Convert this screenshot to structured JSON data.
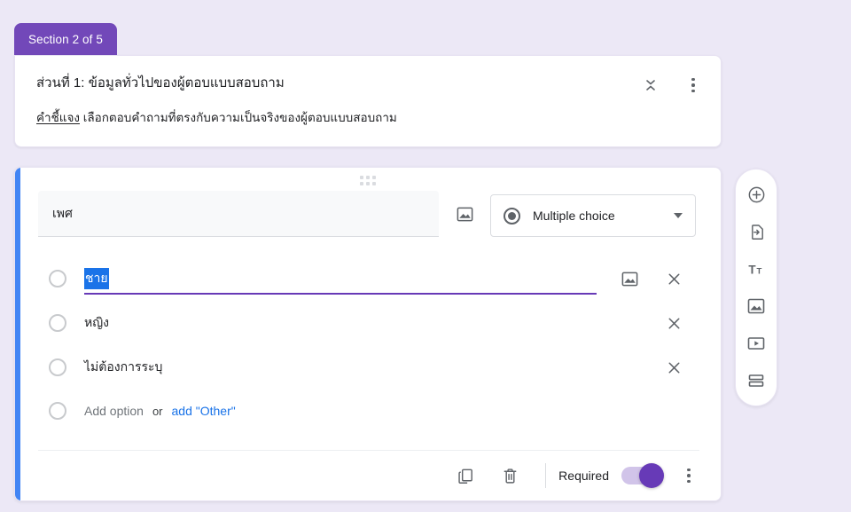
{
  "section": {
    "tab_label": "Section 2 of 5",
    "title": "ส่วนที่ 1: ข้อมูลทั่วไปของผู้ตอบแบบสอบถาม",
    "description_underlined": "คำชี้แจง",
    "description_rest": " เลือกตอบคำถามที่ตรงกับความเป็นจริงของผู้ตอบแบบสอบถาม",
    "collapse_icon": "collapse-icon",
    "more_icon": "more-vert-icon"
  },
  "question": {
    "title": "เพศ",
    "title_image_icon": "image-icon",
    "type_label": "Multiple choice",
    "type_icon": "radio-filled-icon",
    "type_caret_icon": "chevron-down-icon",
    "drag_handle_icon": "drag-handle-icon",
    "options": [
      {
        "label": "ชาย",
        "selected": true,
        "has_image_button": true,
        "image_icon": "image-icon",
        "remove_icon": "close-icon"
      },
      {
        "label": "หญิง",
        "selected": false,
        "has_image_button": false,
        "remove_icon": "close-icon"
      },
      {
        "label": "ไม่ต้องการระบุ",
        "selected": false,
        "has_image_button": false,
        "remove_icon": "close-icon"
      }
    ],
    "add_option_label": "Add option",
    "or_label": "or",
    "add_other_label": "add \"Other\"",
    "footer": {
      "duplicate_icon": "duplicate-icon",
      "delete_icon": "trash-icon",
      "required_label": "Required",
      "required_on": true,
      "more_icon": "more-vert-icon"
    }
  },
  "side_toolbar": {
    "items": [
      {
        "name": "add-question-button",
        "icon": "add-circle-icon"
      },
      {
        "name": "import-questions-button",
        "icon": "import-icon"
      },
      {
        "name": "add-title-button",
        "icon": "title-text-icon"
      },
      {
        "name": "add-image-button",
        "icon": "image-icon"
      },
      {
        "name": "add-video-button",
        "icon": "video-icon"
      },
      {
        "name": "add-section-button",
        "icon": "section-icon"
      }
    ]
  },
  "colors": {
    "page_background": "#ECE8F6",
    "section_tab": "#7248B9",
    "card_accent": "#4285F4",
    "selection_highlight": "#1A73E8",
    "focus_underline": "#673AB7",
    "toggle_on": "#673AB7",
    "link": "#1A73E8"
  }
}
